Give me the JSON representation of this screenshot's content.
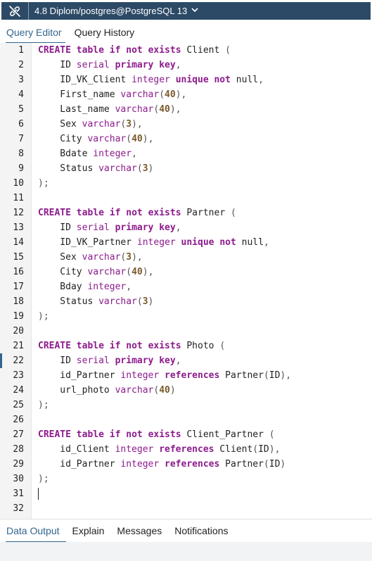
{
  "connection": {
    "title": "4.8 Diplom/postgres@PostgreSQL 13",
    "icon": "link-broken-icon",
    "dropdown_icon": "chevron-down-icon"
  },
  "tabs": [
    {
      "label": "Query Editor",
      "active": true
    },
    {
      "label": "Query History",
      "active": false
    }
  ],
  "editor": {
    "current_line": 22,
    "lines": [
      "CREATE table if not exists Client (",
      "    ID serial primary key,",
      "    ID_VK_Client integer unique not null,",
      "    First_name varchar(40),",
      "    Last_name varchar(40),",
      "    Sex varchar(3),",
      "    City varchar(40),",
      "    Bdate integer,",
      "    Status varchar(3)",
      ");",
      "",
      "CREATE table if not exists Partner (",
      "    ID serial primary key,",
      "    ID_VK_Partner integer unique not null,",
      "    Sex varchar(3),",
      "    City varchar(40),",
      "    Bday integer,",
      "    Status varchar(3)",
      ");",
      "",
      "CREATE table if not exists Photo (",
      "    ID serial primary key,",
      "    id_Partner integer references Partner(ID),",
      "    url_photo varchar(40)",
      ");",
      "",
      "CREATE table if not exists Client_Partner (",
      "    id_Client integer references Client(ID),",
      "    id_Partner integer references Partner(ID)",
      ");",
      "",
      ""
    ]
  },
  "bottom_tabs": [
    {
      "label": "Data Output",
      "active": true
    },
    {
      "label": "Explain",
      "active": false
    },
    {
      "label": "Messages",
      "active": false
    },
    {
      "label": "Notifications",
      "active": false
    }
  ],
  "colors": {
    "header_bg": "#2c4a66",
    "accent": "#326690",
    "keyword": "#8c1b8c",
    "number": "#7a5a2a"
  }
}
